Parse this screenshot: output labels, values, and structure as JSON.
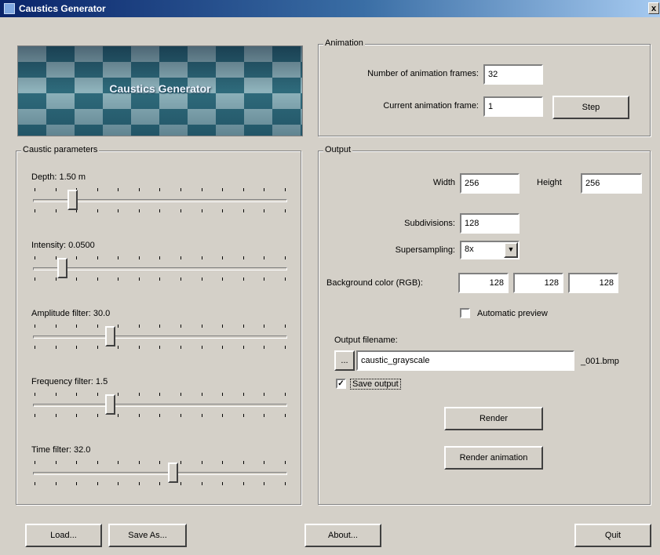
{
  "window": {
    "title": "Caustics Generator",
    "close_glyph": "x"
  },
  "banner": {
    "title": "Caustics Generator"
  },
  "animation": {
    "group_label": "Animation",
    "frames_label": "Number of animation frames:",
    "frames_value": "32",
    "current_label": "Current animation frame:",
    "current_value": "1",
    "step_label": "Step"
  },
  "caustic_parameters": {
    "group_label": "Caustic parameters",
    "sliders": [
      {
        "label": "Depth:  1.50 m",
        "position": 0.15
      },
      {
        "label": "Intensity: 0.0500",
        "position": 0.11
      },
      {
        "label": "Amplitude filter:  30.0",
        "position": 0.3
      },
      {
        "label": "Frequency filter:  1.5",
        "position": 0.3
      },
      {
        "label": "Time filter:   32.0",
        "position": 0.55
      }
    ]
  },
  "output": {
    "group_label": "Output",
    "width_label": "Width",
    "width_value": "256",
    "height_label": "Height",
    "height_value": "256",
    "subdivisions_label": "Subdivisions:",
    "subdivisions_value": "128",
    "supersampling_label": "Supersampling:",
    "supersampling_value": "8x",
    "background_label": "Background color (RGB):",
    "bg_r": "128",
    "bg_g": "128",
    "bg_b": "128",
    "auto_preview_label": "Automatic preview",
    "auto_preview_checked": false,
    "filename_label": "Output filename:",
    "browse_label": "...",
    "filename_value": "caustic_grayscale",
    "filename_suffix": "_001.bmp",
    "save_output_label": "Save output",
    "save_output_checked": true,
    "render_label": "Render",
    "render_animation_label": "Render animation"
  },
  "footer": {
    "load_label": "Load...",
    "save_as_label": "Save As...",
    "about_label": "About...",
    "quit_label": "Quit"
  }
}
